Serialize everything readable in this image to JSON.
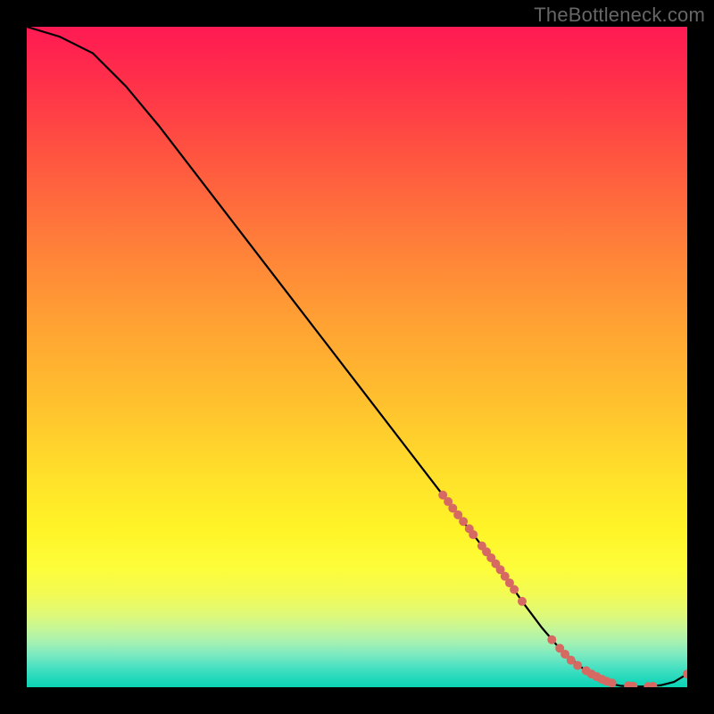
{
  "watermark": {
    "text": "TheBottleneck.com"
  },
  "chart_data": {
    "type": "line",
    "title": "",
    "xlabel": "",
    "ylabel": "",
    "xlim": [
      0,
      100
    ],
    "ylim": [
      0,
      100
    ],
    "annotations": [
      "TheBottleneck.com"
    ],
    "curve": {
      "x": [
        0,
        5,
        10,
        15,
        20,
        25,
        30,
        35,
        40,
        45,
        50,
        55,
        60,
        63,
        66,
        69,
        72,
        75,
        78,
        81,
        84,
        86,
        88,
        90,
        92,
        94,
        96,
        98,
        100
      ],
      "y": [
        100,
        98.5,
        96,
        91,
        85,
        78.5,
        72,
        65.5,
        59,
        52.5,
        46,
        39.5,
        33,
        29.1,
        25.2,
        21.3,
        17.4,
        13.0,
        9.0,
        5.5,
        3.0,
        1.5,
        0.6,
        0.2,
        0.1,
        0.1,
        0.3,
        0.8,
        2.0
      ]
    },
    "markers": [
      {
        "x": 63.0,
        "y": 29.1,
        "r": 5
      },
      {
        "x": 63.8,
        "y": 28.1,
        "r": 5
      },
      {
        "x": 64.5,
        "y": 27.1,
        "r": 5
      },
      {
        "x": 65.3,
        "y": 26.1,
        "r": 5
      },
      {
        "x": 66.1,
        "y": 25.1,
        "r": 5
      },
      {
        "x": 67.0,
        "y": 24.0,
        "r": 5
      },
      {
        "x": 67.6,
        "y": 23.1,
        "r": 5
      },
      {
        "x": 68.9,
        "y": 21.4,
        "r": 5
      },
      {
        "x": 69.6,
        "y": 20.5,
        "r": 5
      },
      {
        "x": 70.3,
        "y": 19.6,
        "r": 5
      },
      {
        "x": 71.0,
        "y": 18.7,
        "r": 5
      },
      {
        "x": 71.7,
        "y": 17.8,
        "r": 5
      },
      {
        "x": 72.4,
        "y": 16.8,
        "r": 5
      },
      {
        "x": 73.1,
        "y": 15.8,
        "r": 5
      },
      {
        "x": 73.8,
        "y": 14.8,
        "r": 5
      },
      {
        "x": 75.0,
        "y": 13.0,
        "r": 5
      },
      {
        "x": 79.5,
        "y": 7.2,
        "r": 5
      },
      {
        "x": 80.7,
        "y": 5.9,
        "r": 5
      },
      {
        "x": 81.5,
        "y": 5.0,
        "r": 5
      },
      {
        "x": 82.4,
        "y": 4.1,
        "r": 5
      },
      {
        "x": 83.4,
        "y": 3.3,
        "r": 5
      },
      {
        "x": 84.7,
        "y": 2.5,
        "r": 5
      },
      {
        "x": 85.5,
        "y": 2.0,
        "r": 5
      },
      {
        "x": 86.3,
        "y": 1.6,
        "r": 5
      },
      {
        "x": 87.1,
        "y": 1.2,
        "r": 5
      },
      {
        "x": 87.8,
        "y": 0.9,
        "r": 5
      },
      {
        "x": 88.6,
        "y": 0.65,
        "r": 5
      },
      {
        "x": 91.1,
        "y": 0.22,
        "r": 5
      },
      {
        "x": 91.8,
        "y": 0.16,
        "r": 5
      },
      {
        "x": 94.1,
        "y": 0.1,
        "r": 5
      },
      {
        "x": 94.8,
        "y": 0.14,
        "r": 5
      },
      {
        "x": 100.0,
        "y": 2.0,
        "r": 5
      }
    ]
  }
}
